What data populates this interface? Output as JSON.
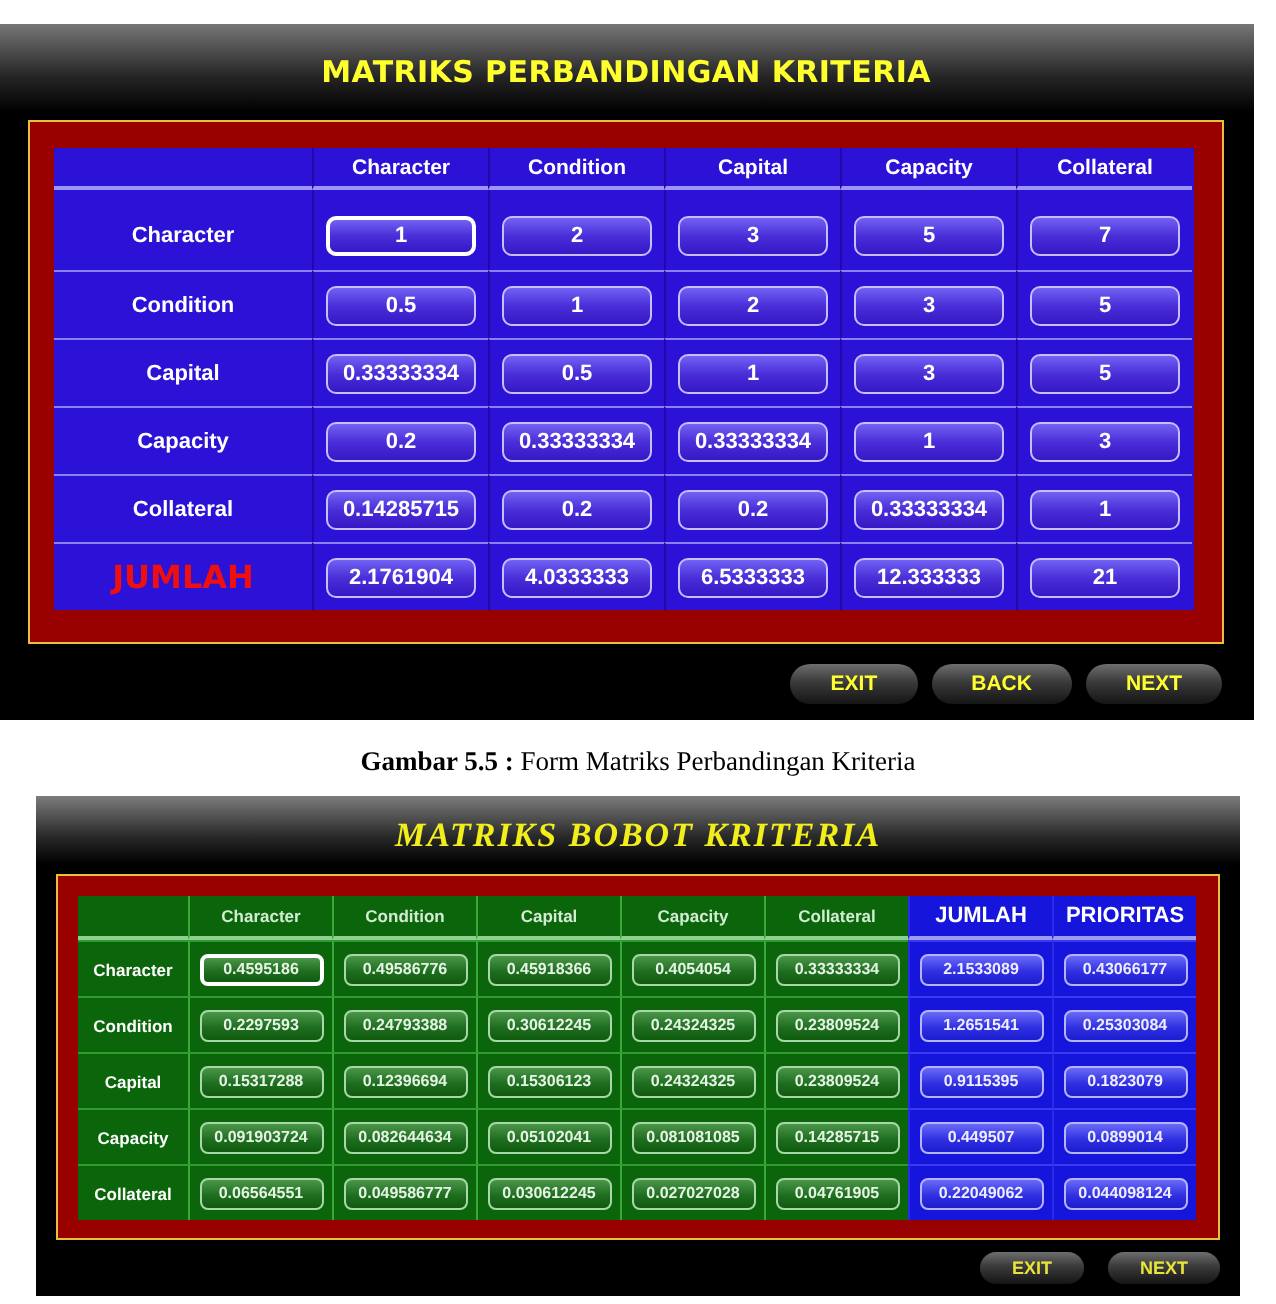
{
  "comparison_form": {
    "title": "MATRIKS PERBANDINGAN KRITERIA",
    "columns": [
      "Character",
      "Condition",
      "Capital",
      "Capacity",
      "Collateral"
    ],
    "rows": [
      {
        "label": "Character",
        "kind": "criterion",
        "cells": [
          {
            "value": "1",
            "focused": true
          },
          {
            "value": "2",
            "focused": false
          },
          {
            "value": "3",
            "focused": false
          },
          {
            "value": "5",
            "focused": false
          },
          {
            "value": "7",
            "focused": false
          }
        ]
      },
      {
        "label": "Condition",
        "kind": "criterion",
        "cells": [
          {
            "value": "0.5",
            "focused": false
          },
          {
            "value": "1",
            "focused": false
          },
          {
            "value": "2",
            "focused": false
          },
          {
            "value": "3",
            "focused": false
          },
          {
            "value": "5",
            "focused": false
          }
        ]
      },
      {
        "label": "Capital",
        "kind": "criterion",
        "cells": [
          {
            "value": "0.33333334",
            "focused": false
          },
          {
            "value": "0.5",
            "focused": false
          },
          {
            "value": "1",
            "focused": false
          },
          {
            "value": "3",
            "focused": false
          },
          {
            "value": "5",
            "focused": false
          }
        ]
      },
      {
        "label": "Capacity",
        "kind": "criterion",
        "cells": [
          {
            "value": "0.2",
            "focused": false
          },
          {
            "value": "0.33333334",
            "focused": false
          },
          {
            "value": "0.33333334",
            "focused": false
          },
          {
            "value": "1",
            "focused": false
          },
          {
            "value": "3",
            "focused": false
          }
        ]
      },
      {
        "label": "Collateral",
        "kind": "criterion",
        "cells": [
          {
            "value": "0.14285715",
            "focused": false
          },
          {
            "value": "0.2",
            "focused": false
          },
          {
            "value": "0.2",
            "focused": false
          },
          {
            "value": "0.33333334",
            "focused": false
          },
          {
            "value": "1",
            "focused": false
          }
        ]
      },
      {
        "label": "JUMLAH",
        "kind": "total",
        "cells": [
          {
            "value": "2.1761904",
            "focused": false
          },
          {
            "value": "4.0333333",
            "focused": false
          },
          {
            "value": "6.5333333",
            "focused": false
          },
          {
            "value": "12.333333",
            "focused": false
          },
          {
            "value": "21",
            "focused": false
          }
        ]
      }
    ],
    "buttons": [
      "EXIT",
      "BACK",
      "NEXT"
    ]
  },
  "caption": "**Gambar 5.5 :** Form Matriks Perbandingan Kriteria",
  "weight_form": {
    "title": "MATRIKS BOBOT KRITERIA",
    "columns": [
      {
        "label": "Character",
        "kind": "criterion"
      },
      {
        "label": "Condition",
        "kind": "criterion"
      },
      {
        "label": "Capital",
        "kind": "criterion"
      },
      {
        "label": "Capacity",
        "kind": "criterion"
      },
      {
        "label": "Collateral",
        "kind": "criterion"
      },
      {
        "label": "JUMLAH",
        "kind": "summary"
      },
      {
        "label": "PRIORITAS",
        "kind": "summary"
      }
    ],
    "rows": [
      {
        "label": "Character",
        "cells": [
          {
            "value": "0.4595186",
            "focused": true
          },
          {
            "value": "0.49586776",
            "focused": false
          },
          {
            "value": "0.45918366",
            "focused": false
          },
          {
            "value": "0.4054054",
            "focused": false
          },
          {
            "value": "0.33333334",
            "focused": false
          },
          {
            "value": "2.1533089",
            "focused": false
          },
          {
            "value": "0.43066177",
            "focused": false
          }
        ]
      },
      {
        "label": "Condition",
        "cells": [
          {
            "value": "0.2297593",
            "focused": false
          },
          {
            "value": "0.24793388",
            "focused": false
          },
          {
            "value": "0.30612245",
            "focused": false
          },
          {
            "value": "0.24324325",
            "focused": false
          },
          {
            "value": "0.23809524",
            "focused": false
          },
          {
            "value": "1.2651541",
            "focused": false
          },
          {
            "value": "0.25303084",
            "focused": false
          }
        ]
      },
      {
        "label": "Capital",
        "cells": [
          {
            "value": "0.15317288",
            "focused": false
          },
          {
            "value": "0.12396694",
            "focused": false
          },
          {
            "value": "0.15306123",
            "focused": false
          },
          {
            "value": "0.24324325",
            "focused": false
          },
          {
            "value": "0.23809524",
            "focused": false
          },
          {
            "value": "0.9115395",
            "focused": false
          },
          {
            "value": "0.1823079",
            "focused": false
          }
        ]
      },
      {
        "label": "Capacity",
        "cells": [
          {
            "value": "0.091903724",
            "focused": false
          },
          {
            "value": "0.082644634",
            "focused": false
          },
          {
            "value": "0.05102041",
            "focused": false
          },
          {
            "value": "0.081081085",
            "focused": false
          },
          {
            "value": "0.14285715",
            "focused": false
          },
          {
            "value": "0.449507",
            "focused": false
          },
          {
            "value": "0.0899014",
            "focused": false
          }
        ]
      },
      {
        "label": "Collateral",
        "cells": [
          {
            "value": "0.06564551",
            "focused": false
          },
          {
            "value": "0.049586777",
            "focused": false
          },
          {
            "value": "0.030612245",
            "focused": false
          },
          {
            "value": "0.027027028",
            "focused": false
          },
          {
            "value": "0.04761905",
            "focused": false
          },
          {
            "value": "0.22049062",
            "focused": false
          },
          {
            "value": "0.044098124",
            "focused": false
          }
        ]
      }
    ],
    "buttons": [
      "EXIT",
      "NEXT"
    ]
  }
}
